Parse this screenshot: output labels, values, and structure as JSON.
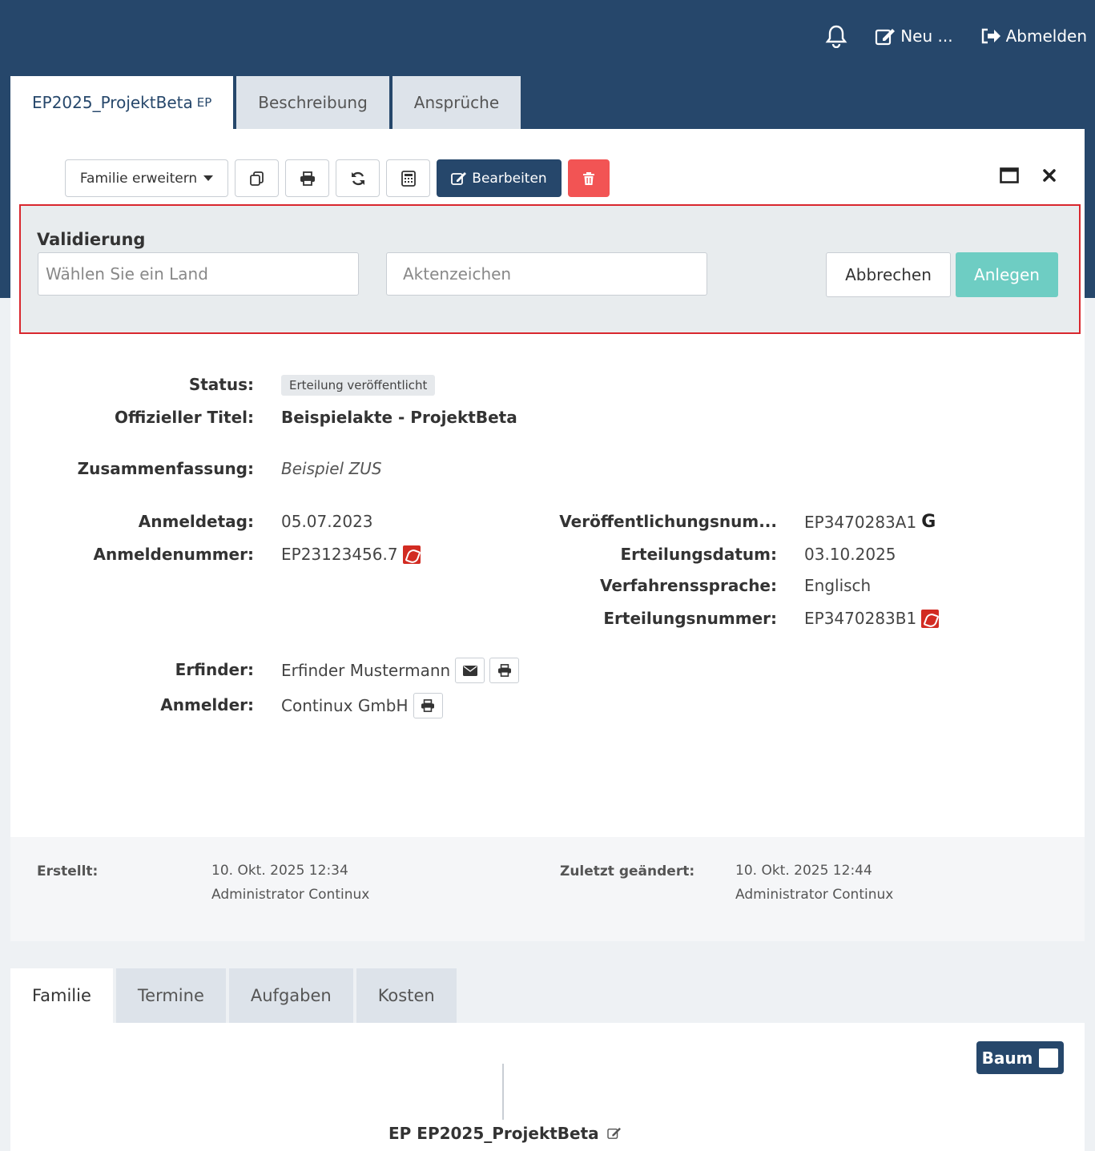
{
  "header": {
    "new_label": "Neu ...",
    "logout_label": "Abmelden"
  },
  "top_tabs": [
    {
      "label": "EP2025_ProjektBeta",
      "suffix": "EP"
    },
    {
      "label": "Beschreibung"
    },
    {
      "label": "Ansprüche"
    }
  ],
  "toolbar": {
    "family_dropdown": "Familie erweitern",
    "edit_label": "Bearbeiten"
  },
  "validation": {
    "title": "Validierung",
    "country_placeholder": "Wählen Sie ein Land",
    "reference_placeholder": "Aktenzeichen",
    "cancel_label": "Abbrechen",
    "create_label": "Anlegen"
  },
  "details": {
    "status_label": "Status:",
    "status_value": "Erteilung veröffentlicht",
    "title_label": "Offizieller Titel:",
    "title_value": "Beispielakte - ProjektBeta",
    "summary_label": "Zusammenfassung:",
    "summary_value": "Beispiel ZUS",
    "filing_date_label": "Anmeldetag:",
    "filing_date_value": "05.07.2023",
    "application_number_label": "Anmeldenummer:",
    "application_number_value": "EP23123456.7",
    "publication_number_label": "Veröffentlichungsnum...",
    "publication_number_value": "EP3470283A1",
    "grant_date_label": "Erteilungsdatum:",
    "grant_date_value": "03.10.2025",
    "language_label": "Verfahrenssprache:",
    "language_value": "Englisch",
    "grant_number_label": "Erteilungsnummer:",
    "grant_number_value": "EP3470283B1",
    "inventor_label": "Erfinder:",
    "inventor_value": "Erfinder Mustermann",
    "applicant_label": "Anmelder:",
    "applicant_value": "Continux GmbH"
  },
  "meta": {
    "created_label": "Erstellt:",
    "created_date": "10. Okt. 2025 12:34",
    "created_by": "Administrator Continux",
    "modified_label": "Zuletzt geändert:",
    "modified_date": "10. Okt. 2025 12:44",
    "modified_by": "Administrator Continux"
  },
  "bottom_tabs": [
    "Familie",
    "Termine",
    "Aufgaben",
    "Kosten"
  ],
  "family": {
    "tree_toggle_label": "Baum",
    "node_label": "EP EP2025_ProjektBeta"
  },
  "colors": {
    "brand": "#26476b",
    "danger": "#f25454",
    "accent": "#6ecdc3",
    "highlight_border": "#d9272e"
  }
}
